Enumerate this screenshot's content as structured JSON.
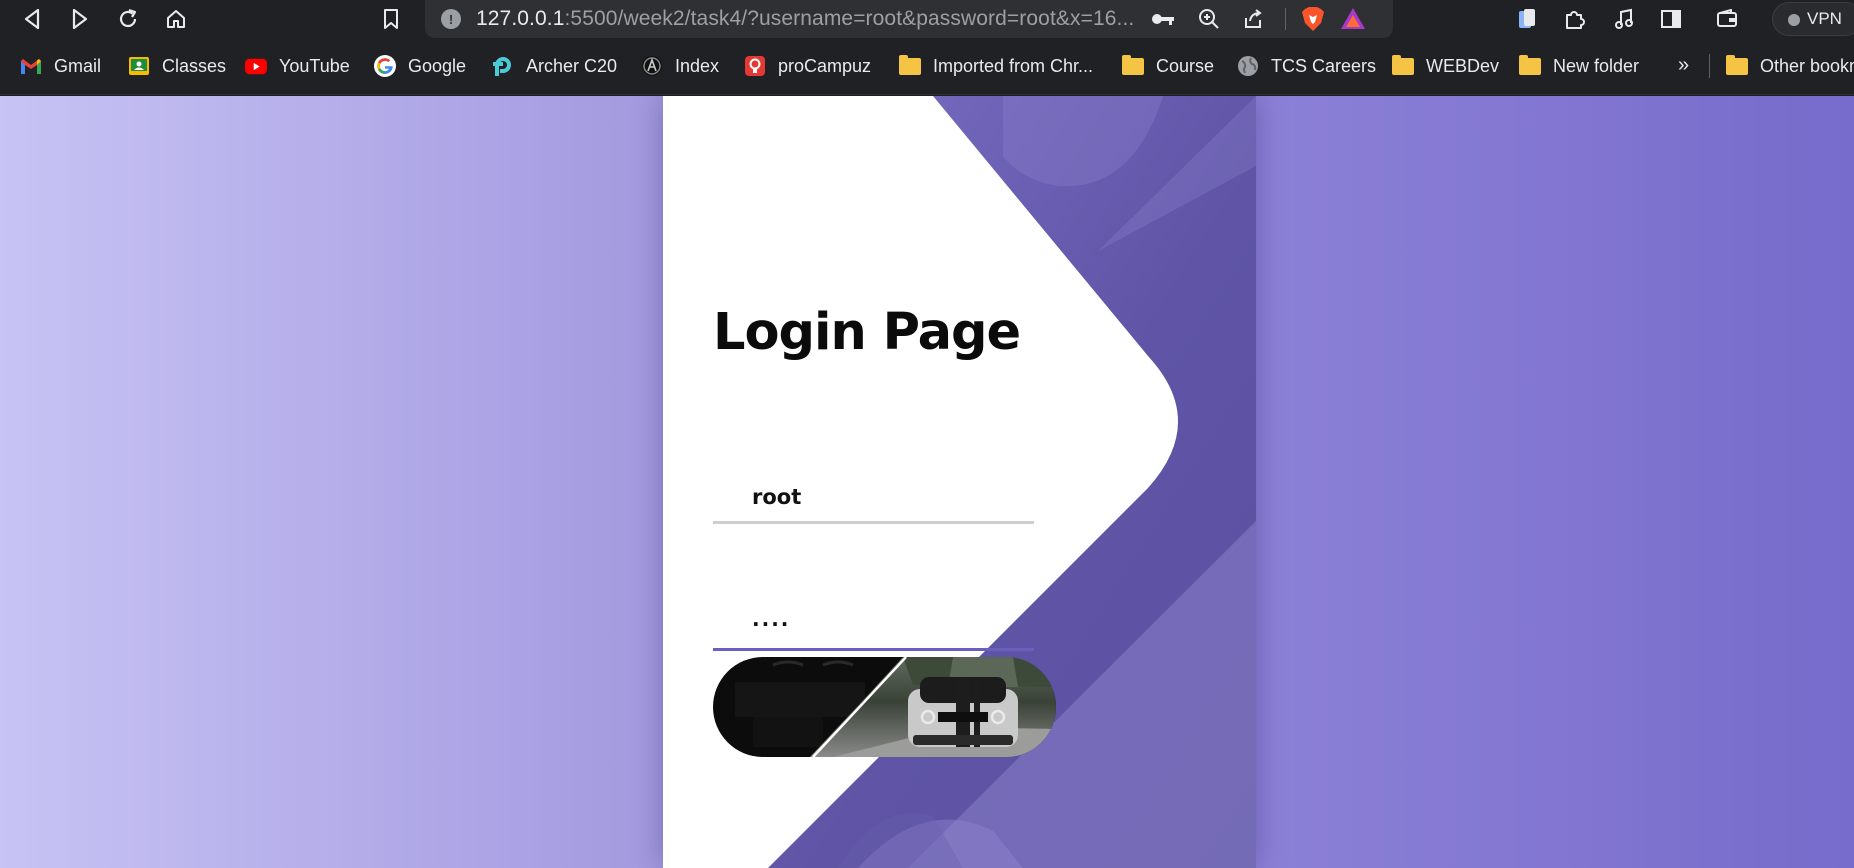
{
  "browser": {
    "url_host": "127.0.0.1",
    "url_rest": ":5500/week2/task4/?username=root&password=root&x=16...",
    "vpn_label": "VPN",
    "toolbar_icons": [
      "back-icon",
      "forward-icon",
      "reload-icon",
      "home-icon",
      "bookmark-icon",
      "info-icon",
      "key-icon",
      "zoom-icon",
      "share-icon",
      "brave-shield-icon",
      "brave-rewards-icon",
      "wallet-icon",
      "extensions-icon",
      "music-icon",
      "sidebar-icon",
      "wallet-icon"
    ]
  },
  "bookmarks": [
    {
      "label": "Gmail",
      "icon": "gmail-icon"
    },
    {
      "label": "Classes",
      "icon": "classroom-icon"
    },
    {
      "label": "YouTube",
      "icon": "youtube-icon"
    },
    {
      "label": "Google",
      "icon": "google-icon"
    },
    {
      "label": "Archer C20",
      "icon": "tplink-icon"
    },
    {
      "label": "Index",
      "icon": "index-icon"
    },
    {
      "label": "proCampuz",
      "icon": "procampuz-icon"
    },
    {
      "label": "Imported from Chr...",
      "icon": "folder-icon"
    },
    {
      "label": "Course",
      "icon": "folder-icon"
    },
    {
      "label": "TCS Careers",
      "icon": "globe-icon"
    },
    {
      "label": "WEBDev",
      "icon": "folder-icon"
    },
    {
      "label": "New folder",
      "icon": "folder-icon"
    }
  ],
  "bookmarks_more": "»",
  "other_bookmarks": "Other bookmarks",
  "page": {
    "title": "Login Page",
    "username_value": "root",
    "password_masked": "····",
    "colors": {
      "accent": "#6a5fbc",
      "bg_left": "#c7c3f4",
      "bg_right": "#776bcb",
      "card": "#ffffff"
    }
  }
}
